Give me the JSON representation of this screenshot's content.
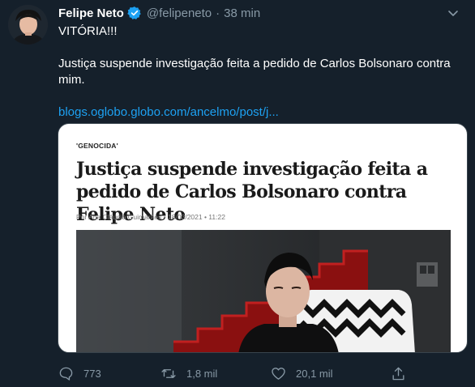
{
  "tweet": {
    "author_name": "Felipe Neto",
    "handle": "@felipeneto",
    "separator": "·",
    "time": "38 min",
    "verified": true,
    "text_line1": "VITÓRIA!!!",
    "text_line2": "Justiça suspende investigação feita a pedido de Carlos Bolsonaro contra mim.",
    "link": "blogs.oglobo.globo.com/ancelmo/post/j..."
  },
  "card": {
    "tag": "'GENOCIDA'",
    "headline": "Justiça suspende investigação feita a pedido de Carlos Bolsonaro contra Felipe Neto",
    "byline": "Por Ana Cláudia Guimarães • 18/03/2021 • 11:22"
  },
  "actions": {
    "replies": "773",
    "retweets": "1,8 mil",
    "likes": "20,1 mil"
  },
  "icons": {
    "menu": "chevron-down-icon",
    "verified": "verified-badge-icon",
    "reply": "reply-icon",
    "retweet": "retweet-icon",
    "like": "heart-icon",
    "share": "share-icon"
  },
  "colors": {
    "background": "#15202b",
    "text": "#ffffff",
    "muted": "#8899a6",
    "link": "#1da1f2",
    "verified": "#1da1f2"
  }
}
